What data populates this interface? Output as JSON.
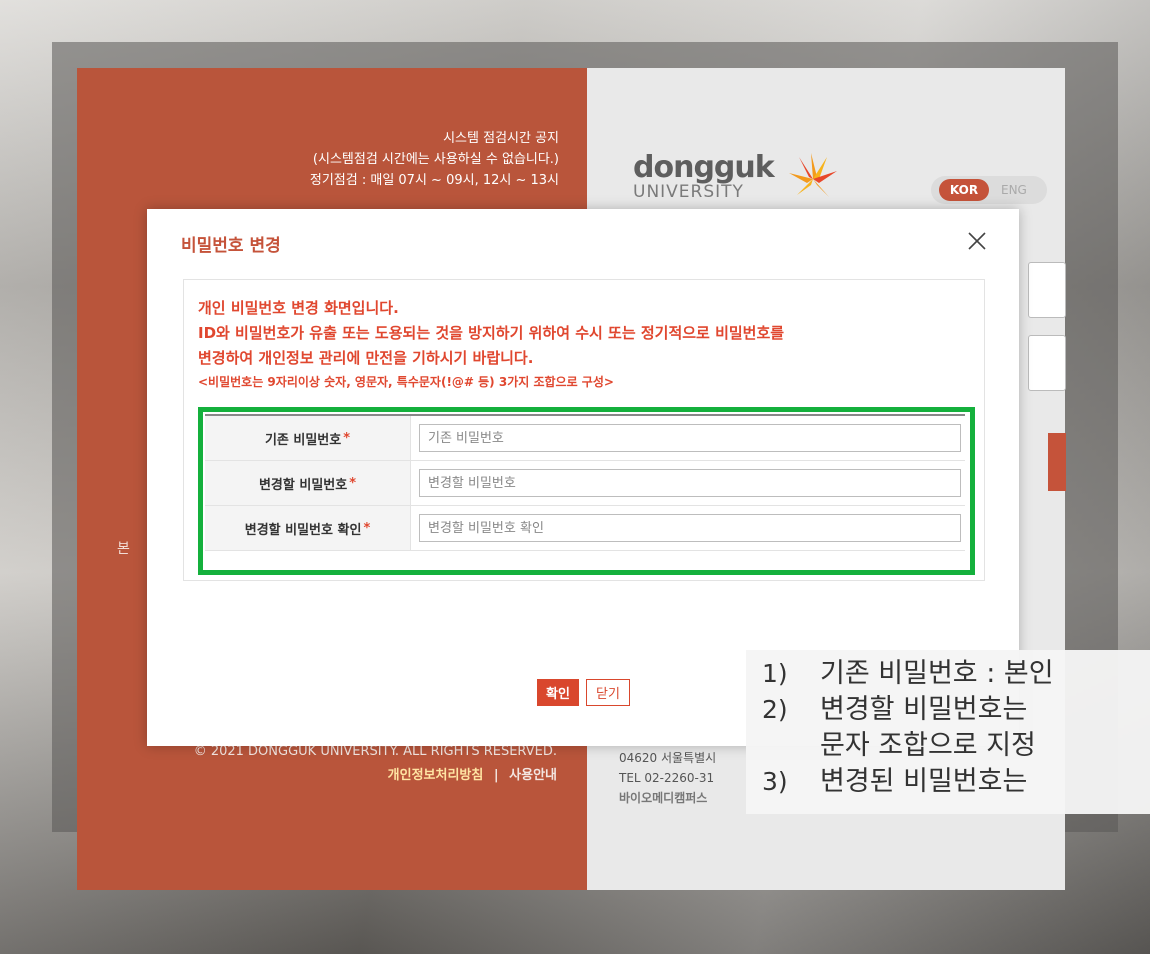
{
  "left_panel": {
    "notice_title": "시스템 점검시간 공지",
    "notice_line2": "(시스템점검 시간에는 사용하실 수 없습니다.)",
    "notice_line3": "정기점검 : 매일 07시 ~ 09시, 12시 ~ 13시",
    "side_text": "본",
    "copyright": "© 2021 DONGGUK UNIVERSITY. ALL RIGHTS RESERVED.",
    "privacy_link": "개인정보처리방침",
    "separator": "|",
    "guide_link": "사용안내"
  },
  "right_panel": {
    "logo_main": "dongguk",
    "logo_sub": "UNIVERSITY",
    "lang_kor": "KOR",
    "lang_eng": "ENG",
    "footer_addr": "04620 서울특별시",
    "footer_tel": "TEL 02-2260-31",
    "footer_bio": "바이오메디캠퍼스"
  },
  "modal": {
    "title": "비밀번호 변경",
    "info_line1": "개인 비밀번호 변경 화면입니다.",
    "info_line2": "ID와 비밀번호가 유출 또는 도용되는 것을 방지하기 위하여 수시 또는 정기적으로 비밀번호를",
    "info_line3": "변경하여 개인정보 관리에 만전을 기하시기 바랍니다.",
    "rule": "<비밀번호는 9자리이상 숫자, 영문자, 특수문자(!@# 등) 3가지 조합으로 구성>",
    "fields": [
      {
        "label": "기존 비밀번호",
        "required": "*",
        "placeholder": "기존 비밀번호"
      },
      {
        "label": "변경할 비밀번호",
        "required": "*",
        "placeholder": "변경할 비밀번호"
      },
      {
        "label": "변경할 비밀번호 확인",
        "required": "*",
        "placeholder": "변경할 비밀번호 확인"
      }
    ],
    "ok_label": "확인",
    "close_label": "닫기"
  },
  "callout": {
    "items": [
      {
        "num": "1)",
        "text": "기존 비밀번호 : 본인"
      },
      {
        "num": "2)",
        "text": "변경할 비밀번호는"
      },
      {
        "num": "",
        "text": "문자 조합으로 지정"
      },
      {
        "num": "3)",
        "text": "변경된 비밀번호는"
      }
    ]
  },
  "colors": {
    "brand": "#b9553b",
    "accent_red": "#e0472f",
    "highlight_green": "#14b03c"
  }
}
